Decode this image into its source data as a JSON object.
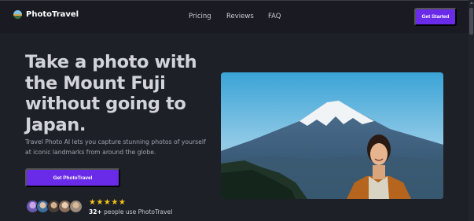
{
  "header": {
    "brand": "PhotoTravel",
    "logo_icon": "sunset-landscape-icon",
    "nav": [
      "Pricing",
      "Reviews",
      "FAQ"
    ],
    "cta_label": "Get Started"
  },
  "hero": {
    "title": "Take a photo with the Mount Fuji without going to Japan.",
    "description": "Travel Photo AI lets you capture stunning photos of yourself at iconic landmarks from around the globe.",
    "cta_label": "Get PhotoTravel",
    "rating_stars": "★★★★★",
    "rating": 5,
    "social_count": "32+",
    "social_text": " people use PhotoTravel",
    "image_icon": "mount-fuji-portrait-photo"
  },
  "colors": {
    "background": "#1e2028",
    "header": "#1a1b22",
    "accent": "#6a2be8",
    "star": "#f5c518"
  }
}
